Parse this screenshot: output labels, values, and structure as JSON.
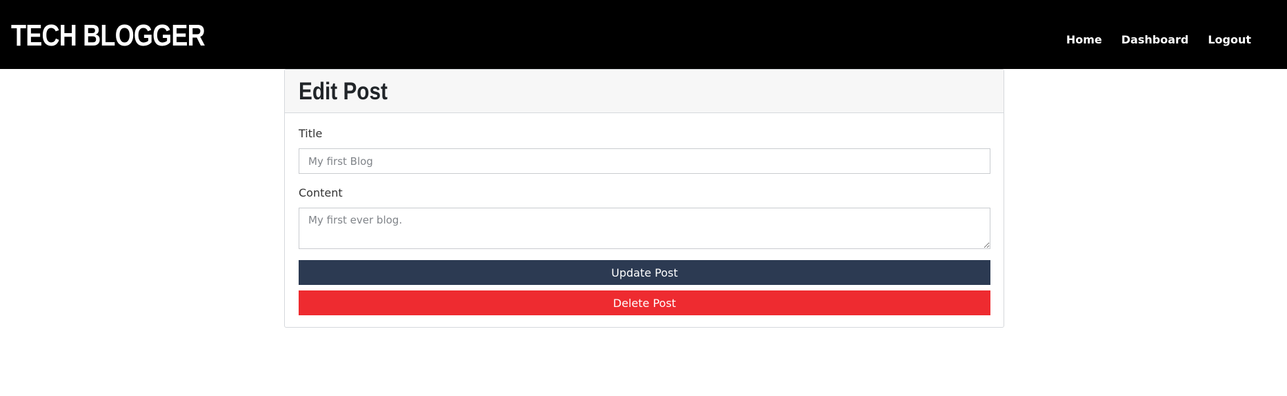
{
  "navbar": {
    "brand": "TECH BLOGGER",
    "links": [
      {
        "label": "Home"
      },
      {
        "label": "Dashboard"
      },
      {
        "label": "Logout"
      }
    ],
    "background": "#000000"
  },
  "card": {
    "title": "Edit Post",
    "form": {
      "title_label": "Title",
      "title_placeholder": "My first Blog",
      "content_label": "Content",
      "content_placeholder": "My first ever blog.",
      "update_label": "Update Post",
      "delete_label": "Delete Post"
    }
  },
  "colors": {
    "update_button": "#2c3a52",
    "delete_button": "#ee2b30",
    "header_bg": "#f7f7f7"
  }
}
